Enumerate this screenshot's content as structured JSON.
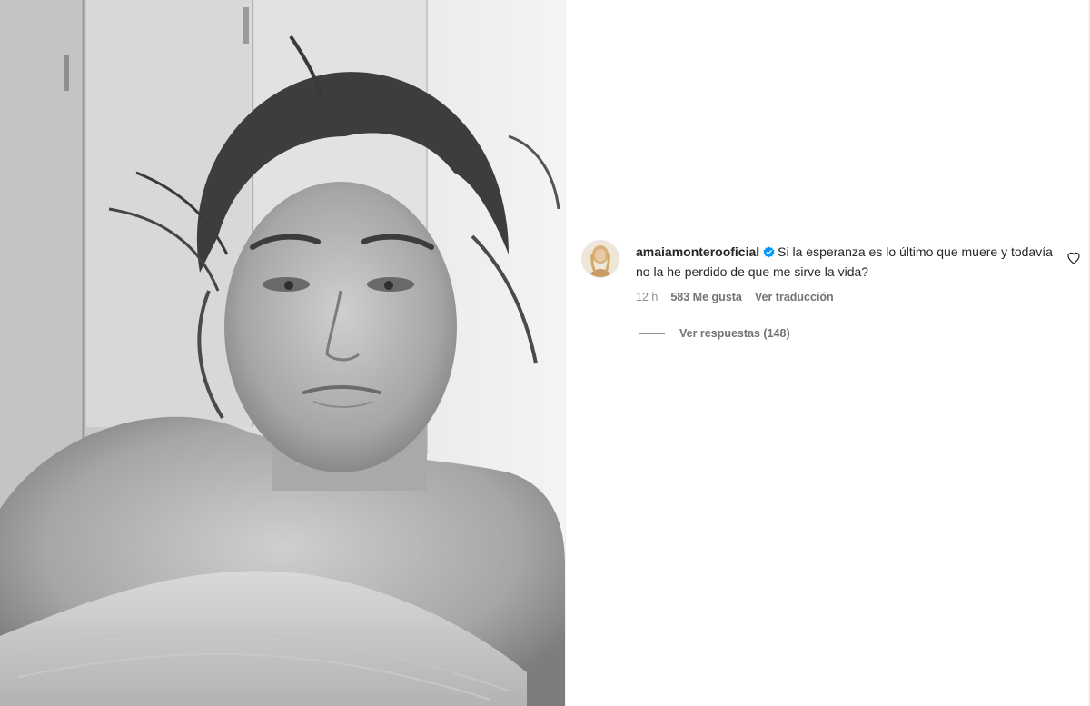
{
  "post": {
    "image_alt": "Black and white selfie of a woman with messy hair wrapped in a towel"
  },
  "comment": {
    "username": "amaiamonterooficial",
    "verified": true,
    "text": "Si la esperanza es lo último que muere y todavía no la he perdido de que me sirve la vida?",
    "time": "12 h",
    "likes": "583 Me gusta",
    "translate": "Ver traducción",
    "view_replies": "Ver respuestas (148)"
  },
  "colors": {
    "verified_badge": "#0095f6",
    "secondary_text": "#8e8e8e"
  },
  "icons": [
    "verified-badge-icon",
    "heart-icon"
  ]
}
